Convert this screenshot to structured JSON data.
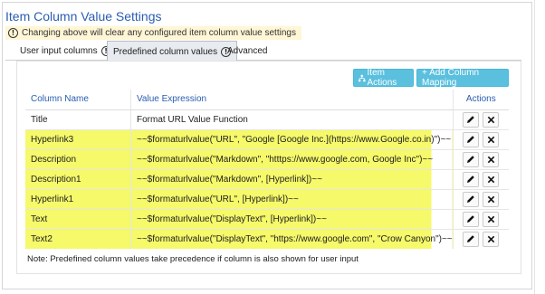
{
  "page": {
    "title": "Item Column Value Settings",
    "warning": "Changing above will clear any configured item column value settings",
    "info_glyph": "!"
  },
  "tabs": [
    {
      "label": "User input columns",
      "has_info": true,
      "active": false
    },
    {
      "label": "Predefined column values",
      "has_info": true,
      "active": true
    },
    {
      "label": "Advanced",
      "has_info": false,
      "active": false
    }
  ],
  "toolbar": {
    "item_actions_label": "Item Actions",
    "item_actions_icon": "sitemap-icon",
    "add_mapping_label": "+ Add Column Mapping"
  },
  "table": {
    "headers": {
      "column_name": "Column Name",
      "value_expression": "Value Expression",
      "actions": "Actions"
    },
    "rows": [
      {
        "name": "Title",
        "expr": "Format URL Value Function",
        "highlight": false
      },
      {
        "name": "Hyperlink3",
        "expr": "~~$formaturlvalue(\"URL\", \"Google [Google Inc.](https://www.Google.co.in)\")~~",
        "highlight": true
      },
      {
        "name": "Description",
        "expr": "~~$formaturlvalue(\"Markdown\", \"htttps://www.google.com, Google Inc\")~~",
        "highlight": true
      },
      {
        "name": "Description1",
        "expr": "~~$formaturlvalue(\"Markdown\", [Hyperlink])~~",
        "highlight": true
      },
      {
        "name": "Hyperlink1",
        "expr": "~~$formaturlvalue(\"URL\", [Hyperlink])~~",
        "highlight": true
      },
      {
        "name": "Text",
        "expr": "~~$formaturlvalue(\"DisplayText\", [Hyperlink])~~",
        "highlight": true
      },
      {
        "name": "Text2",
        "expr": "~~$formaturlvalue(\"DisplayText\", \"https://www.google.com\", \"Crow Canyon\")~~",
        "highlight": true
      }
    ],
    "edit_icon": "pencil-icon",
    "delete_icon": "close-icon"
  },
  "note": "Note: Predefined column values take precedence if column is also shown for user input",
  "colors": {
    "accent": "#2a5db0",
    "button": "#5bc0de",
    "highlight": "#f5f96a",
    "warning_bg": "#fff6d6"
  }
}
